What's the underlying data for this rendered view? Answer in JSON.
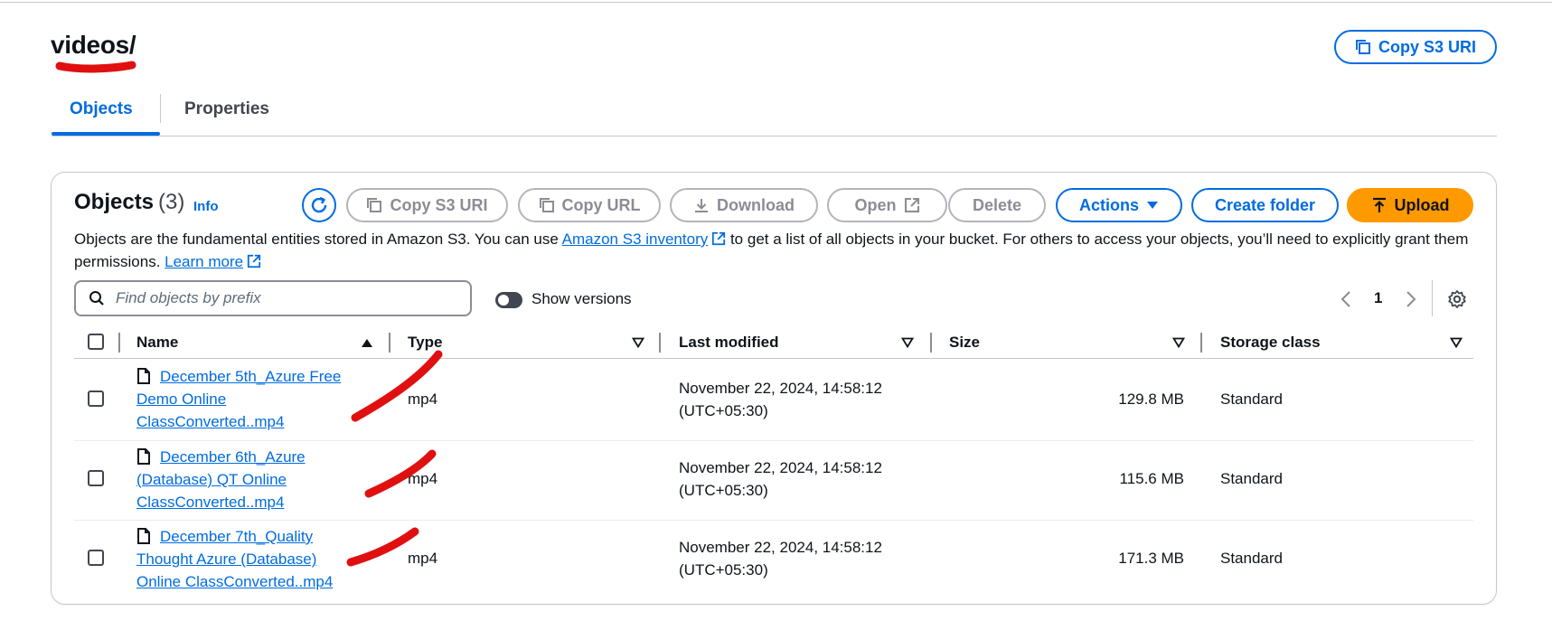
{
  "page": {
    "title": "videos/",
    "copy_s3_uri_label": "Copy S3 URI"
  },
  "tabs": [
    {
      "label": "Objects",
      "active": true
    },
    {
      "label": "Properties",
      "active": false
    }
  ],
  "objects_panel": {
    "title": "Objects",
    "count": "(3)",
    "info_label": "Info",
    "toolbar": {
      "copy_s3_uri": "Copy S3 URI",
      "copy_url": "Copy URL",
      "download": "Download",
      "open": "Open",
      "delete": "Delete",
      "actions": "Actions",
      "create_folder": "Create folder",
      "upload": "Upload"
    },
    "description": {
      "part1": "Objects are the fundamental entities stored in Amazon S3. You can use ",
      "link1": "Amazon S3 inventory",
      "part2": " to get a list of all objects in your bucket. For others to access your objects, you’ll need to explicitly grant them permissions. ",
      "link2": "Learn more"
    },
    "search": {
      "placeholder": "Find objects by prefix",
      "value": ""
    },
    "show_versions_label": "Show versions",
    "show_versions_on": false,
    "pagination": {
      "current_page": "1"
    },
    "columns": [
      "Name",
      "Type",
      "Last modified",
      "Size",
      "Storage class"
    ],
    "rows": [
      {
        "name": "December 5th_Azure Free Demo Online ClassConverted..mp4",
        "type": "mp4",
        "last_modified": "November 22, 2024, 14:58:12 (UTC+05:30)",
        "size": "129.8 MB",
        "storage_class": "Standard"
      },
      {
        "name": "December 6th_Azure (Database) QT Online ClassConverted..mp4",
        "type": "mp4",
        "last_modified": "November 22, 2024, 14:58:12 (UTC+05:30)",
        "size": "115.6 MB",
        "storage_class": "Standard"
      },
      {
        "name": "December 7th_Quality Thought Azure (Database) Online ClassConverted..mp4",
        "type": "mp4",
        "last_modified": "November 22, 2024, 14:58:12 (UTC+05:30)",
        "size": "171.3 MB",
        "storage_class": "Standard"
      }
    ]
  },
  "colors": {
    "accent": "#006ce0",
    "upload": "#ff9900",
    "disabled": "#8c8c94",
    "annotation": "#e01010"
  },
  "icons": [
    "copy-icon",
    "refresh-icon",
    "download-icon",
    "external-link-icon",
    "caret-down-icon",
    "upload-icon",
    "search-icon",
    "chevron-left-icon",
    "chevron-right-icon",
    "gear-icon",
    "file-icon",
    "sort-ascending-icon",
    "sort-descending-icon"
  ]
}
